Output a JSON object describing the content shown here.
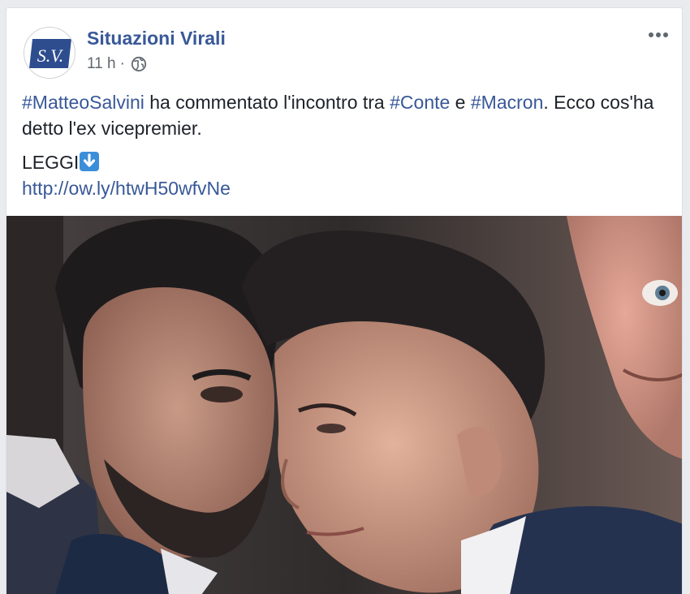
{
  "post": {
    "page_name": "Situazioni Virali",
    "avatar_text": "S.V.",
    "timestamp": "11 h",
    "separator": "·",
    "privacy_icon": "globe-icon",
    "more_icon": "more-options-icon",
    "text": {
      "hashtag_1": "#MatteoSalvini",
      "segment_1": " ha commentato l'incontro tra ",
      "hashtag_2": "#Conte",
      "segment_2": " e ",
      "hashtag_3": "#Macron",
      "segment_3": ". Ecco cos'ha detto l'ex vicepremier.",
      "leggi": "LEGGI",
      "leggi_emoji": "down-arrow-emoji",
      "link": "http://ow.ly/htwH50wfvNe"
    },
    "photo": {
      "subject": "Photo of two men in suits talking closely, a third man in the background"
    }
  },
  "colors": {
    "page_bg": "#e9ebee",
    "card_bg": "#ffffff",
    "link": "#385898",
    "text": "#1d2129",
    "meta": "#616770",
    "brand_blue": "#2d4d8f"
  }
}
